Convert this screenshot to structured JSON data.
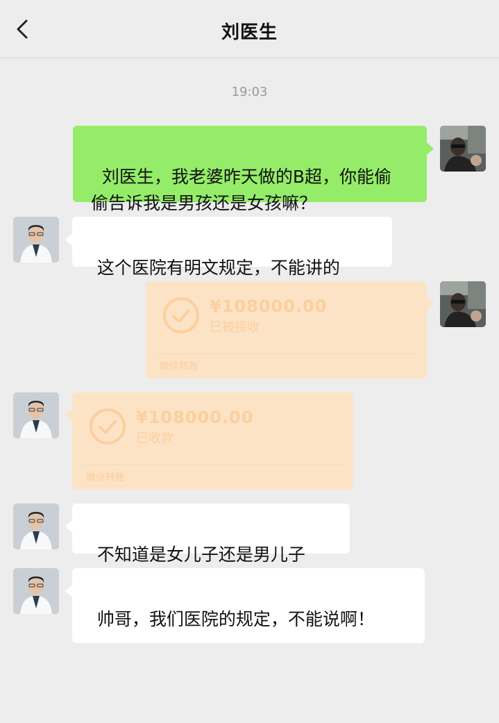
{
  "header": {
    "title": "刘医生"
  },
  "timestamp": "19:03",
  "messages": {
    "m1": "刘医生，我老婆昨天做的B超，你能偷偷告诉我是男孩还是女孩嘛？",
    "m2": "这个医院有明文规定，不能讲的",
    "m3": {
      "amount": "¥108000.00",
      "status": "已被接收",
      "label": "微信转账"
    },
    "m4": {
      "amount": "¥108000.00",
      "status": "已收款",
      "label": "微信转账"
    },
    "m5": "不知道是女儿子还是男儿子",
    "m6": "帅哥，我们医院的规定，不能说啊！"
  },
  "colors": {
    "outgoing_bubble": "#95ec69",
    "incoming_bubble": "#ffffff",
    "transfer_card": "#fde3c6",
    "background": "#ededed"
  },
  "icons": {
    "back": "chevron-left-icon",
    "transfer": "check-circle-icon"
  }
}
